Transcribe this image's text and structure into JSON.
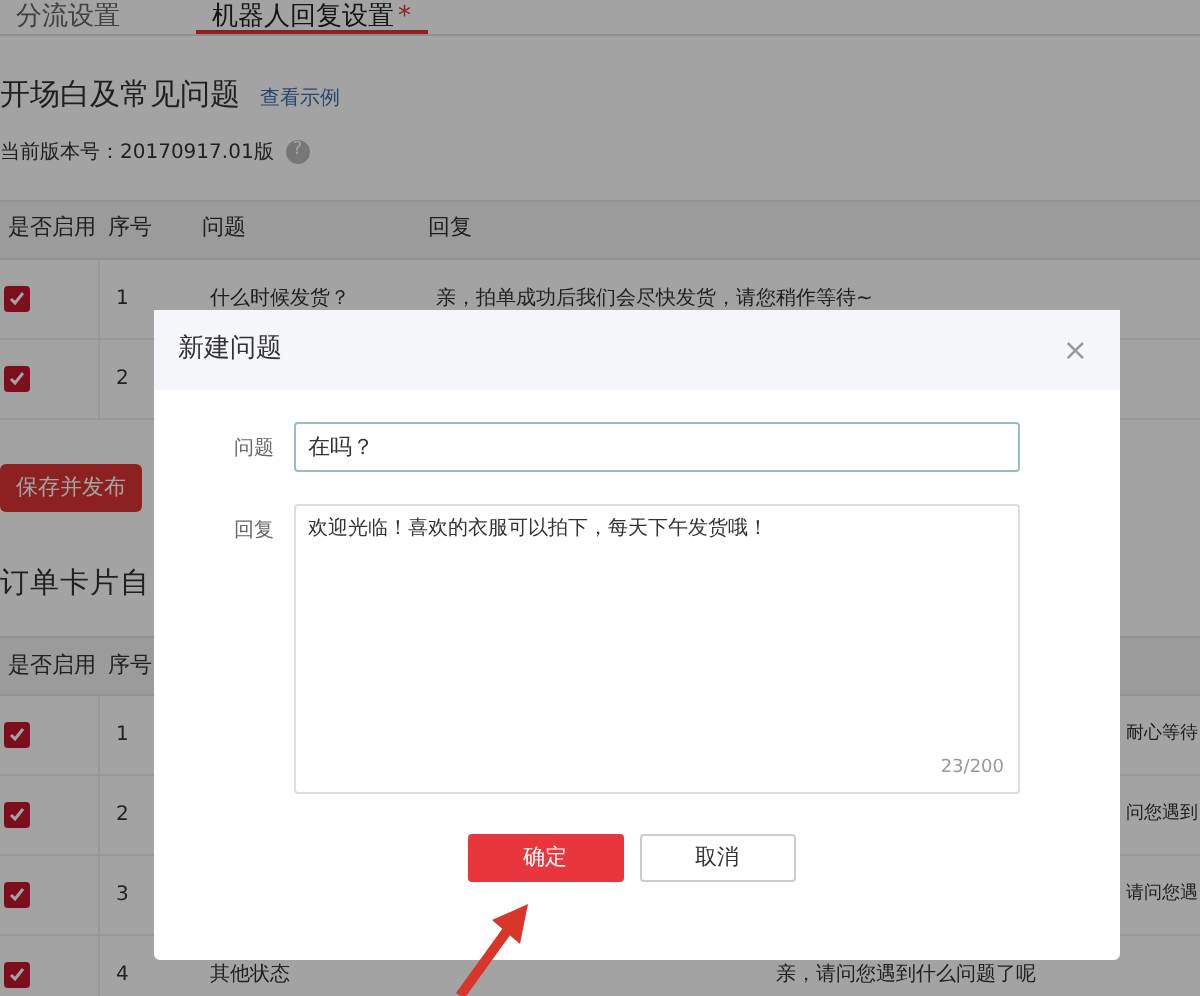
{
  "tabs": [
    {
      "label": "分流设置",
      "selected": false
    },
    {
      "label": "机器人回复设置",
      "selected": true,
      "required_mark": "*"
    }
  ],
  "faq_section": {
    "title": "开场白及常见问题",
    "example_link": "查看示例",
    "version": "当前版本号：20170917.01版",
    "help": "?",
    "columns": [
      "是否启用",
      "序号",
      "问题",
      "回复"
    ],
    "rows": [
      {
        "enabled": true,
        "index": "1",
        "question": "什么时候发货？",
        "reply": "亲，拍单成功后我们会尽快发货，请您稍作等待~"
      },
      {
        "enabled": true,
        "index": "2"
      }
    ],
    "save_button": "保存并发布"
  },
  "order_section": {
    "title": "订单卡片自",
    "columns": [
      "是否启用",
      "序号"
    ],
    "rows": [
      {
        "enabled": true,
        "index": "1",
        "reply": "耐心等待",
        "reply_cut": true
      },
      {
        "enabled": true,
        "index": "2",
        "reply": "问您遇到",
        "reply_cut": true
      },
      {
        "enabled": true,
        "index": "3",
        "reply": "请问您遇",
        "reply_cut": true
      },
      {
        "enabled": true,
        "index": "4",
        "question": "其他状态",
        "reply": "亲，请问您遇到什么问题了呢"
      }
    ]
  },
  "dialog": {
    "title": "新建问题",
    "close": "×",
    "fields": [
      {
        "kind": "input",
        "label": "问题",
        "value": "在吗？",
        "focused": true
      },
      {
        "kind": "textarea",
        "label": "回复",
        "value": "欢迎光临！喜欢的衣服可以拍下，每天下午发货哦！",
        "counter": "23/200",
        "focused": false
      }
    ],
    "buttons": [
      {
        "label": "确定",
        "primary": true
      },
      {
        "label": "取消",
        "primary": false
      }
    ]
  }
}
